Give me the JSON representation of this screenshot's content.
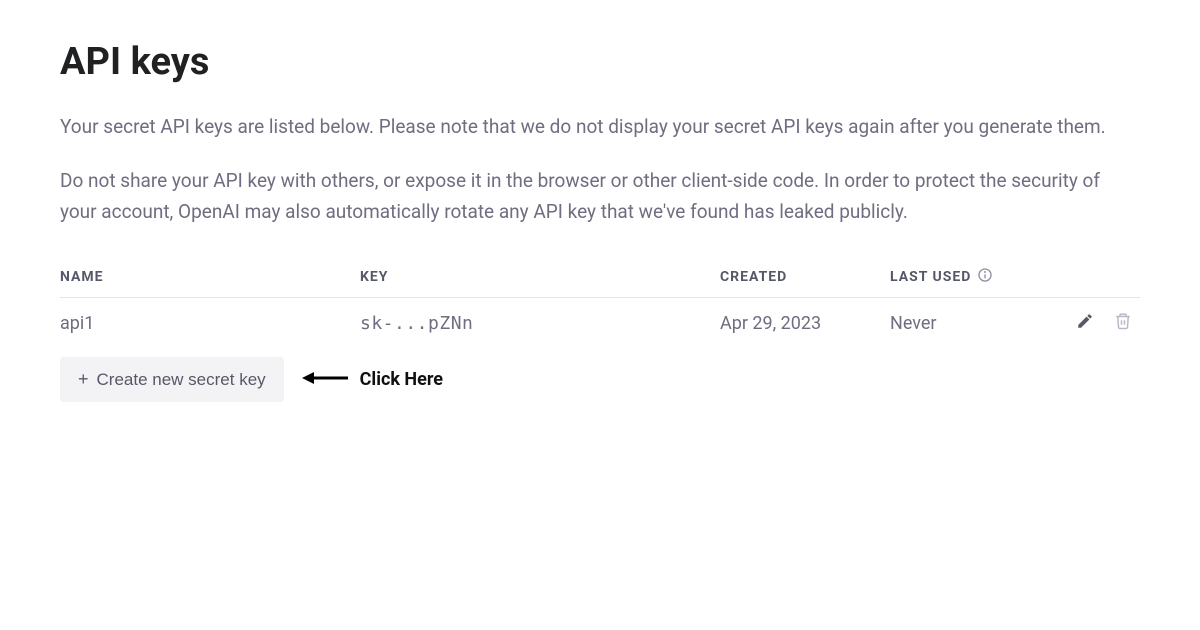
{
  "page": {
    "title": "API keys",
    "description1": "Your secret API keys are listed below. Please note that we do not display your secret API keys again after you generate them.",
    "description2": "Do not share your API key with others, or expose it in the browser or other client-side code. In order to protect the security of your account, OpenAI may also automatically rotate any API key that we've found has leaked publicly."
  },
  "table": {
    "headers": {
      "name": "NAME",
      "key": "KEY",
      "created": "CREATED",
      "lastused": "LAST USED"
    },
    "rows": [
      {
        "name": "api1",
        "key": "sk-...pZNn",
        "created": "Apr 29, 2023",
        "lastused": "Never"
      }
    ]
  },
  "createButton": {
    "label": "Create new secret key"
  },
  "annotation": {
    "clickHere": "Click Here"
  }
}
